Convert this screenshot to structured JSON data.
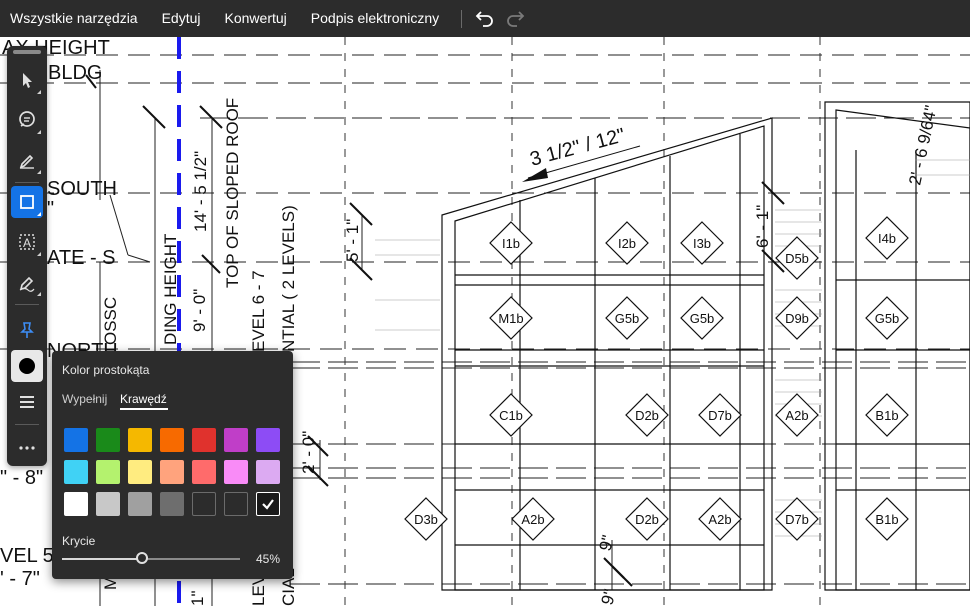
{
  "menu": {
    "items": [
      "Wszystkie narzędzia",
      "Edytuj",
      "Konwertuj",
      "Podpis elektroniczny"
    ],
    "undo_icon": "undo-icon",
    "redo_icon": "redo-icon"
  },
  "drawing": {
    "texts": {
      "max_height": "AX HEIGHT",
      "bldg": "BLDG",
      "south": "SOUTH",
      "south_suffix": "\"",
      "ate_s": "ATE - S",
      "north": "NORTH",
      "dim_8": "\" - 8\"",
      "level5": "VEL 5",
      "dim_7": "' - 7\"",
      "ssc": "OSSC",
      "ding_height": "DING HEIGHT",
      "dim_9_0": "9' - 0\"",
      "dim_14": "14' - 5 1/2\"",
      "top_sloped": "TOP OF SLOPED ROOF",
      "level_6_7": "EVEL 6 - 7",
      "ntial": "NTIAL ( 2 LEVELS)",
      "dim_5_1": "5' - 1\"",
      "slope": "3 1/2\" / 12\"",
      "dim_6_1": "6' - 1\"",
      "dim_6_9": "2' - 6 9/64\"",
      "dim_2_0": "2' - 0\"",
      "dim_9b": "9\"",
      "dim_1": "1\"",
      "lev": "LEV",
      "cial": "CIAL",
      "m": "M",
      "dim_9c": "9\""
    },
    "tags": [
      "I1b",
      "I2b",
      "I3b",
      "D5b",
      "I4b",
      "M1b",
      "G5b",
      "G5b",
      "D9b",
      "G5b",
      "C1b",
      "D2b",
      "D7b",
      "A2b",
      "B1b",
      "D3b",
      "A2b",
      "D2b",
      "A2b",
      "D7b",
      "B1b"
    ]
  },
  "toolbar": {
    "tools": [
      {
        "name": "select-tool",
        "icon": "arrow-cursor-icon"
      },
      {
        "name": "comment-tool",
        "icon": "comment-icon"
      },
      {
        "name": "highlight-tool",
        "icon": "pencil-icon"
      },
      {
        "name": "rectangle-tool",
        "icon": "rectangle-icon",
        "active": true
      },
      {
        "name": "text-box-tool",
        "icon": "text-box-icon"
      },
      {
        "name": "draw-tool",
        "icon": "pen-icon"
      },
      {
        "name": "pin-tool",
        "icon": "pin-icon"
      },
      {
        "name": "color-tool",
        "icon": "color-circle-icon"
      },
      {
        "name": "stroke-width-tool",
        "icon": "lines-icon"
      },
      {
        "name": "more-tool",
        "icon": "more-icon"
      }
    ]
  },
  "color_panel": {
    "title": "Kolor prostokąta",
    "tabs": [
      "Wypełnij",
      "Krawędź"
    ],
    "selected_tab": 1,
    "colors": [
      [
        "#1473e6",
        "#1a8a1a",
        "#f5b800",
        "#f76a00",
        "#e0322d",
        "#c03ec8",
        "#8d4cf5"
      ],
      [
        "#40d2f5",
        "#b4f26e",
        "#ffec80",
        "#ffa37d",
        "#ff6b6b",
        "#f98bf7",
        "#dcaaf2"
      ],
      [
        "#ffffff",
        "#c8c8c8",
        "#a0a0a0",
        "#6e6e6e",
        "",
        "",
        "#000000"
      ]
    ],
    "selected": [
      2,
      6
    ],
    "opacity_label": "Krycie",
    "opacity_value": "45%",
    "opacity_fraction": 0.45
  }
}
